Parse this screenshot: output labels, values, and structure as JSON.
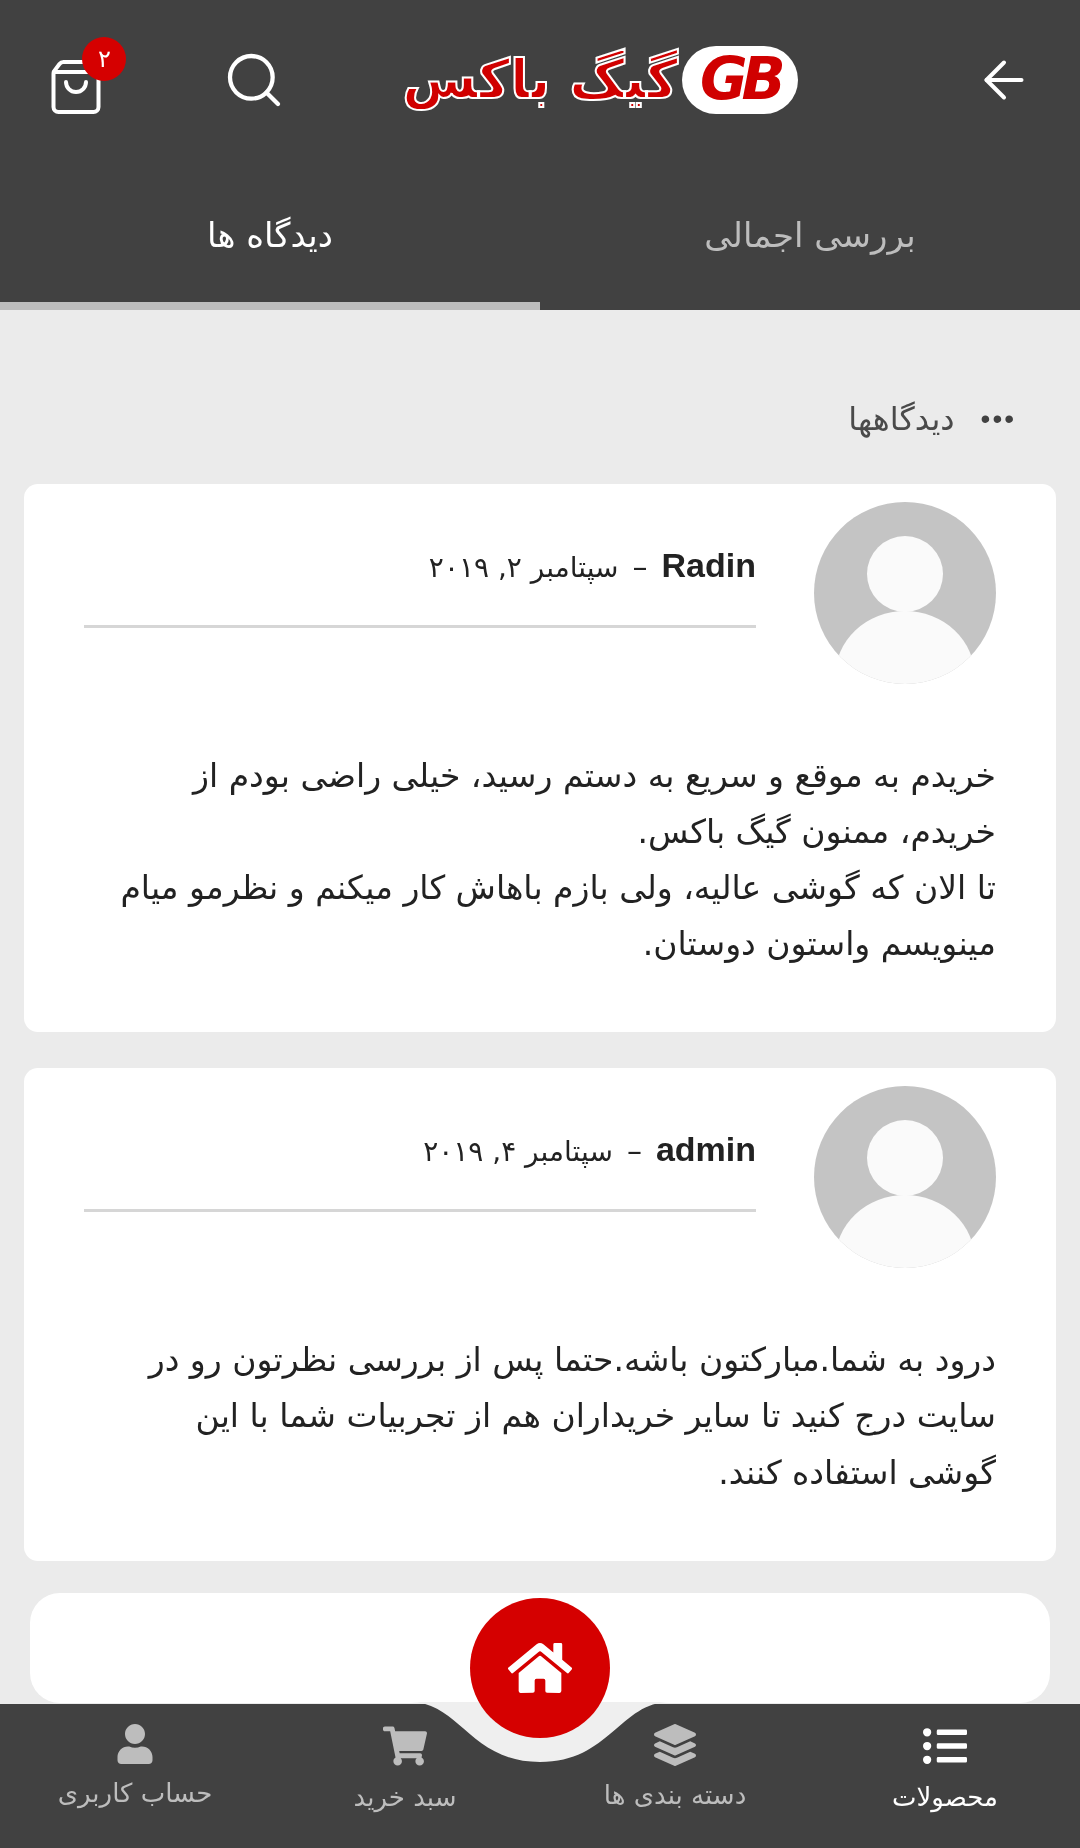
{
  "header": {
    "logo": {
      "wordmark": "گیگ باکس",
      "mark": "GB"
    },
    "cart_badge": "۲"
  },
  "tabs": [
    {
      "label": "بررسی اجمالی",
      "selected": false
    },
    {
      "label": "دیدگاه ها",
      "selected": true
    }
  ],
  "section": {
    "title": "دیدگاهها",
    "menu": "•••"
  },
  "comments": [
    {
      "author": "Radin",
      "separator": "–",
      "date": "سپتامبر ۲, ۲۰۱۹",
      "text": "خریدم به موقع و سریع به دستم رسید، خیلی راضی بودم از خریدم، ممنون گیگ باکس.\nتا الان که گوشی عالیه، ولی بازم باهاش کار میکنم و نظرمو میام مینویسم واستون دوستان."
    },
    {
      "author": "admin",
      "separator": "–",
      "date": "سپتامبر ۴, ۲۰۱۹",
      "text": "درود به شما.مبارکتون باشه.حتما پس از بررسی نظرتون رو در سایت درج کنید تا سایر خریداران هم از تجربیات شما با این گوشی استفاده کنند."
    }
  ],
  "bottom_nav": [
    {
      "kind": "list",
      "label": "محصولات",
      "selected": true
    },
    {
      "kind": "layers",
      "label": "دسته بندی ها",
      "selected": false
    },
    {
      "kind": "cart",
      "label": "سبد خرید",
      "selected": false
    },
    {
      "kind": "user",
      "label": "حساب کاربری",
      "selected": false
    }
  ]
}
